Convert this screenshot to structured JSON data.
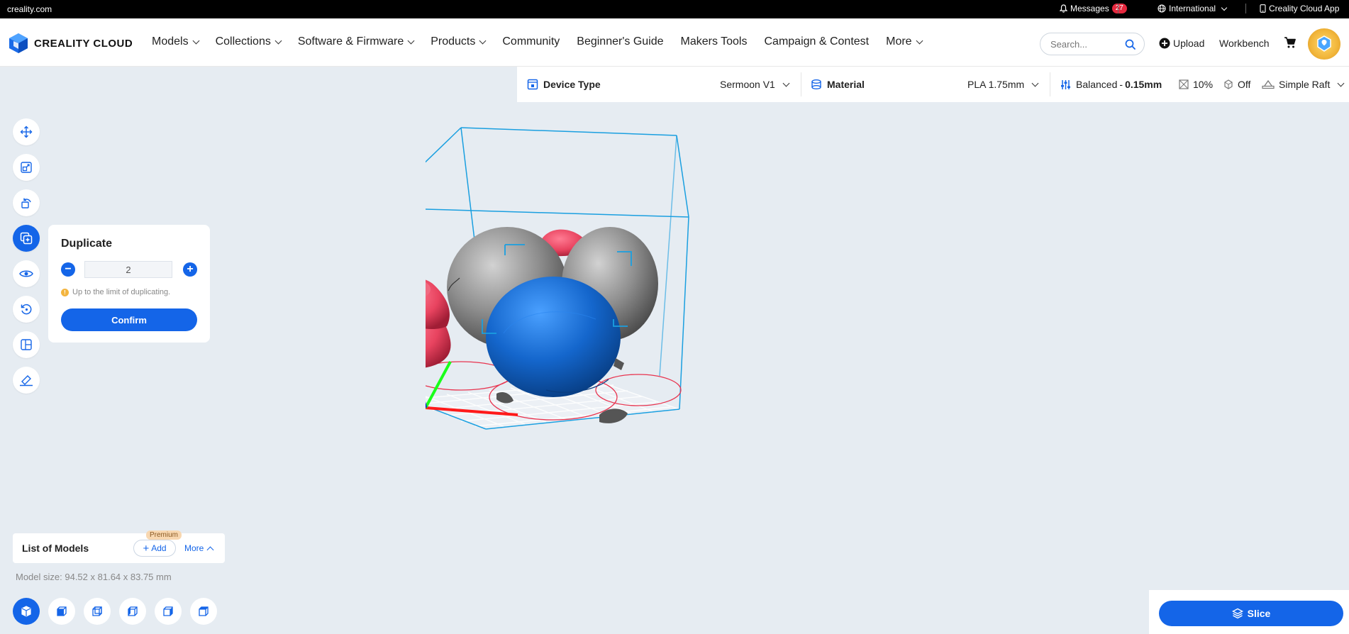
{
  "topbar": {
    "domain": "creality.com",
    "messages_label": "Messages",
    "messages_count": "27",
    "region_label": "International",
    "app_label": "Creality Cloud App"
  },
  "header": {
    "logo_text": "CREALITY CLOUD",
    "nav": [
      {
        "label": "Models",
        "dropdown": true
      },
      {
        "label": "Collections",
        "dropdown": true
      },
      {
        "label": "Software & Firmware",
        "dropdown": true
      },
      {
        "label": "Products",
        "dropdown": true
      },
      {
        "label": "Community",
        "dropdown": false
      },
      {
        "label": "Beginner's Guide",
        "dropdown": false
      },
      {
        "label": "Makers Tools",
        "dropdown": false
      },
      {
        "label": "Campaign & Contest",
        "dropdown": false
      },
      {
        "label": "More",
        "dropdown": true
      }
    ],
    "search_placeholder": "Search...",
    "upload_label": "Upload",
    "workbench_label": "Workbench"
  },
  "settings": {
    "device_type_label": "Device Type",
    "device_value": "Sermoon V1",
    "material_label": "Material",
    "material_value": "PLA 1.75mm",
    "quality_label": "Balanced",
    "quality_value": "0.15mm",
    "quality_separator": "-",
    "infill_value": "10%",
    "support_value": "Off",
    "adhesion_value": "Simple Raft"
  },
  "duplicate": {
    "title": "Duplicate",
    "count": "2",
    "minus": "−",
    "plus": "+",
    "hint_mark": "!",
    "hint": "Up to the limit of duplicating.",
    "confirm_label": "Confirm"
  },
  "models_list": {
    "title": "List of Models",
    "add_label": "Add",
    "add_plus": "+",
    "premium_badge": "Premium",
    "more_label": "More",
    "model_size": "Model size: 94.52 x 81.64 x 83.75 mm"
  },
  "slice": {
    "label": "Slice"
  },
  "colors": {
    "primary": "#1465e8",
    "bbox": "#1a9fe0",
    "pink_model": "#e8435f",
    "gray_model": "#8d8d8d",
    "blue_model": "#1b6fd0"
  },
  "icons": {
    "left_tools": [
      "move-icon",
      "scale-icon",
      "rotate-icon",
      "duplicate-icon",
      "visibility-icon",
      "reset-icon",
      "layout-icon",
      "lay-flat-icon"
    ],
    "view_buttons": [
      "view-default-icon",
      "view-front-icon",
      "view-back-icon",
      "view-left-icon",
      "view-right-icon",
      "view-top-icon"
    ]
  }
}
